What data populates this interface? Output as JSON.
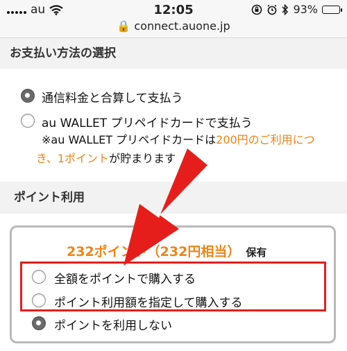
{
  "status_bar": {
    "carrier": "au",
    "time": "12:05",
    "battery_percent": "93%",
    "battery_level": 0.93,
    "url": "connect.auone.jp"
  },
  "payment_section": {
    "title": "お支払い方法の選択",
    "options": [
      {
        "label": "通信料金と合算して支払う",
        "selected": true
      },
      {
        "label": "au WALLET プリペイドカードで支払う",
        "selected": false
      }
    ],
    "note": {
      "line1_prefix": "※au WALLET プリペイドカードは",
      "line1_orange": "200円のご利用につ",
      "line2_orange": "き、1ポイント",
      "line2_suffix": "が貯まります"
    }
  },
  "points_section": {
    "title": "ポイント利用",
    "points_amount": "232ポイント（232円相当）",
    "points_held": "保有",
    "options": [
      {
        "label": "全額をポイントで購入する",
        "selected": false
      },
      {
        "label": "ポイント利用額を指定して購入する",
        "selected": false
      },
      {
        "label": "ポイントを利用しない",
        "selected": true
      }
    ]
  },
  "colors": {
    "accent_orange": "#ef8416",
    "annotation_red": "#e0201c",
    "section_bg": "#f2f2f2"
  }
}
